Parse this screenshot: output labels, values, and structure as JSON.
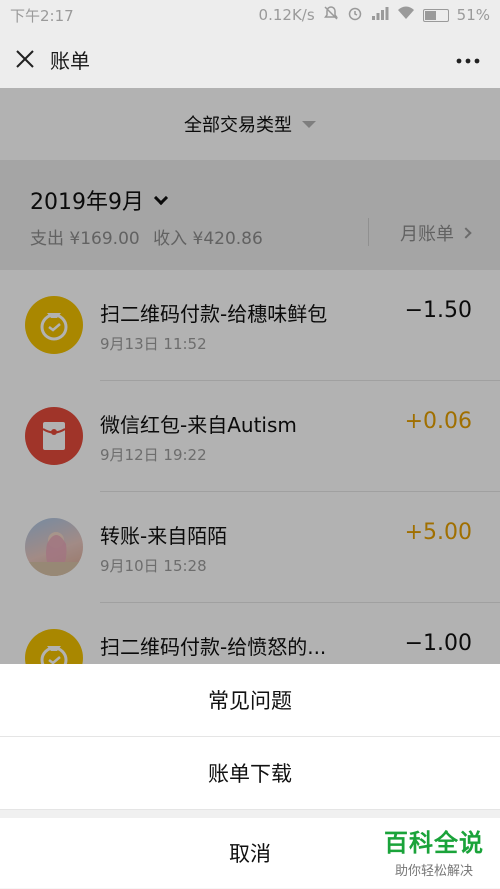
{
  "status_bar": {
    "time": "下午2:17",
    "network_speed": "0.12K/s",
    "battery_percent": "51%",
    "icons": [
      "mute-icon",
      "alarm-icon",
      "signal-icon",
      "wifi-icon",
      "battery-icon"
    ],
    "battery_level": 0.51
  },
  "nav": {
    "close_icon": "close-icon",
    "title": "账单",
    "more_icon": "more-icon"
  },
  "filter": {
    "label": "全部交易类型",
    "icon": "caret-down-icon"
  },
  "month": {
    "label": "2019年9月",
    "expense": "支出 ¥169.00",
    "income": "收入 ¥420.86",
    "monthly_bill": "月账单"
  },
  "transactions": [
    {
      "title": "扫二维码付款-给穗味鲜包",
      "time": "9月13日 11:52",
      "amount": "−1.50",
      "icon": "payment-icon",
      "icon_color": "#f2c200",
      "type": "expense"
    },
    {
      "title": "微信红包-来自Autism",
      "time": "9月12日 19:22",
      "amount": "+0.06",
      "icon": "red-packet-icon",
      "icon_color": "#e64b3b",
      "type": "income"
    },
    {
      "title": "转账-来自陌陌",
      "time": "9月10日 15:28",
      "amount": "+5.00",
      "icon": "avatar",
      "type": "income"
    },
    {
      "title": "扫二维码付款-给愤怒的...",
      "time": "",
      "amount": "−1.00",
      "icon": "payment-icon",
      "icon_color": "#f2c200",
      "type": "expense"
    }
  ],
  "colors": {
    "income": "#e6a000",
    "expense": "#111111",
    "overlay": "rgba(0,0,0,0.30)"
  },
  "action_sheet": {
    "items": [
      "常见问题",
      "账单下载"
    ],
    "cancel": "取消"
  },
  "watermark": {
    "main": "百科全说",
    "sub": "助你轻松解决"
  }
}
